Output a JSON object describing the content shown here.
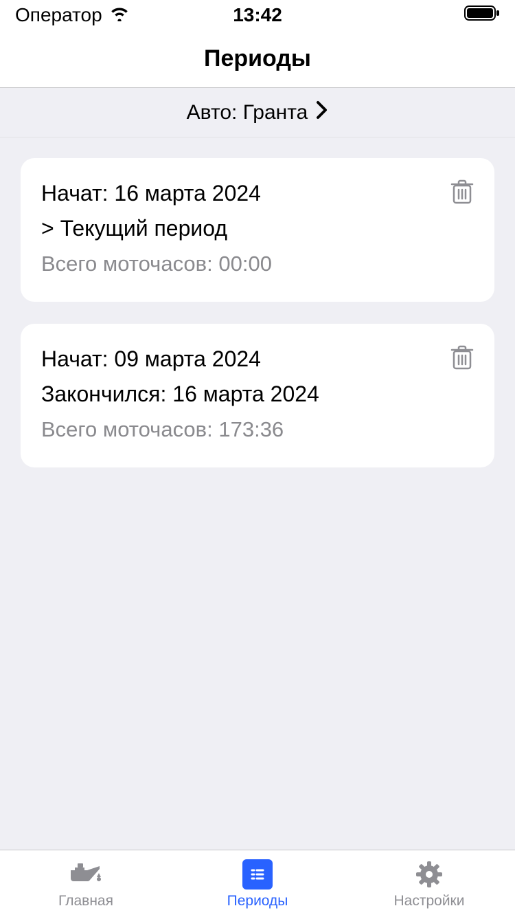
{
  "status": {
    "carrier": "Оператор",
    "time": "13:42"
  },
  "nav": {
    "title": "Периоды"
  },
  "car_selector": {
    "label": "Авто: Гранта"
  },
  "periods": [
    {
      "started": "Начат: 16 марта 2024",
      "second_line": "> Текущий период",
      "hours": "Всего моточасов: 00:00"
    },
    {
      "started": "Начат: 09 марта 2024",
      "second_line": "Закончился: 16 марта 2024",
      "hours": "Всего моточасов: 173:36"
    }
  ],
  "tabs": {
    "home": "Главная",
    "periods": "Периоды",
    "settings": "Настройки"
  },
  "colors": {
    "accent": "#2962ff",
    "muted": "#8e8e93",
    "bg": "#efeff4"
  }
}
